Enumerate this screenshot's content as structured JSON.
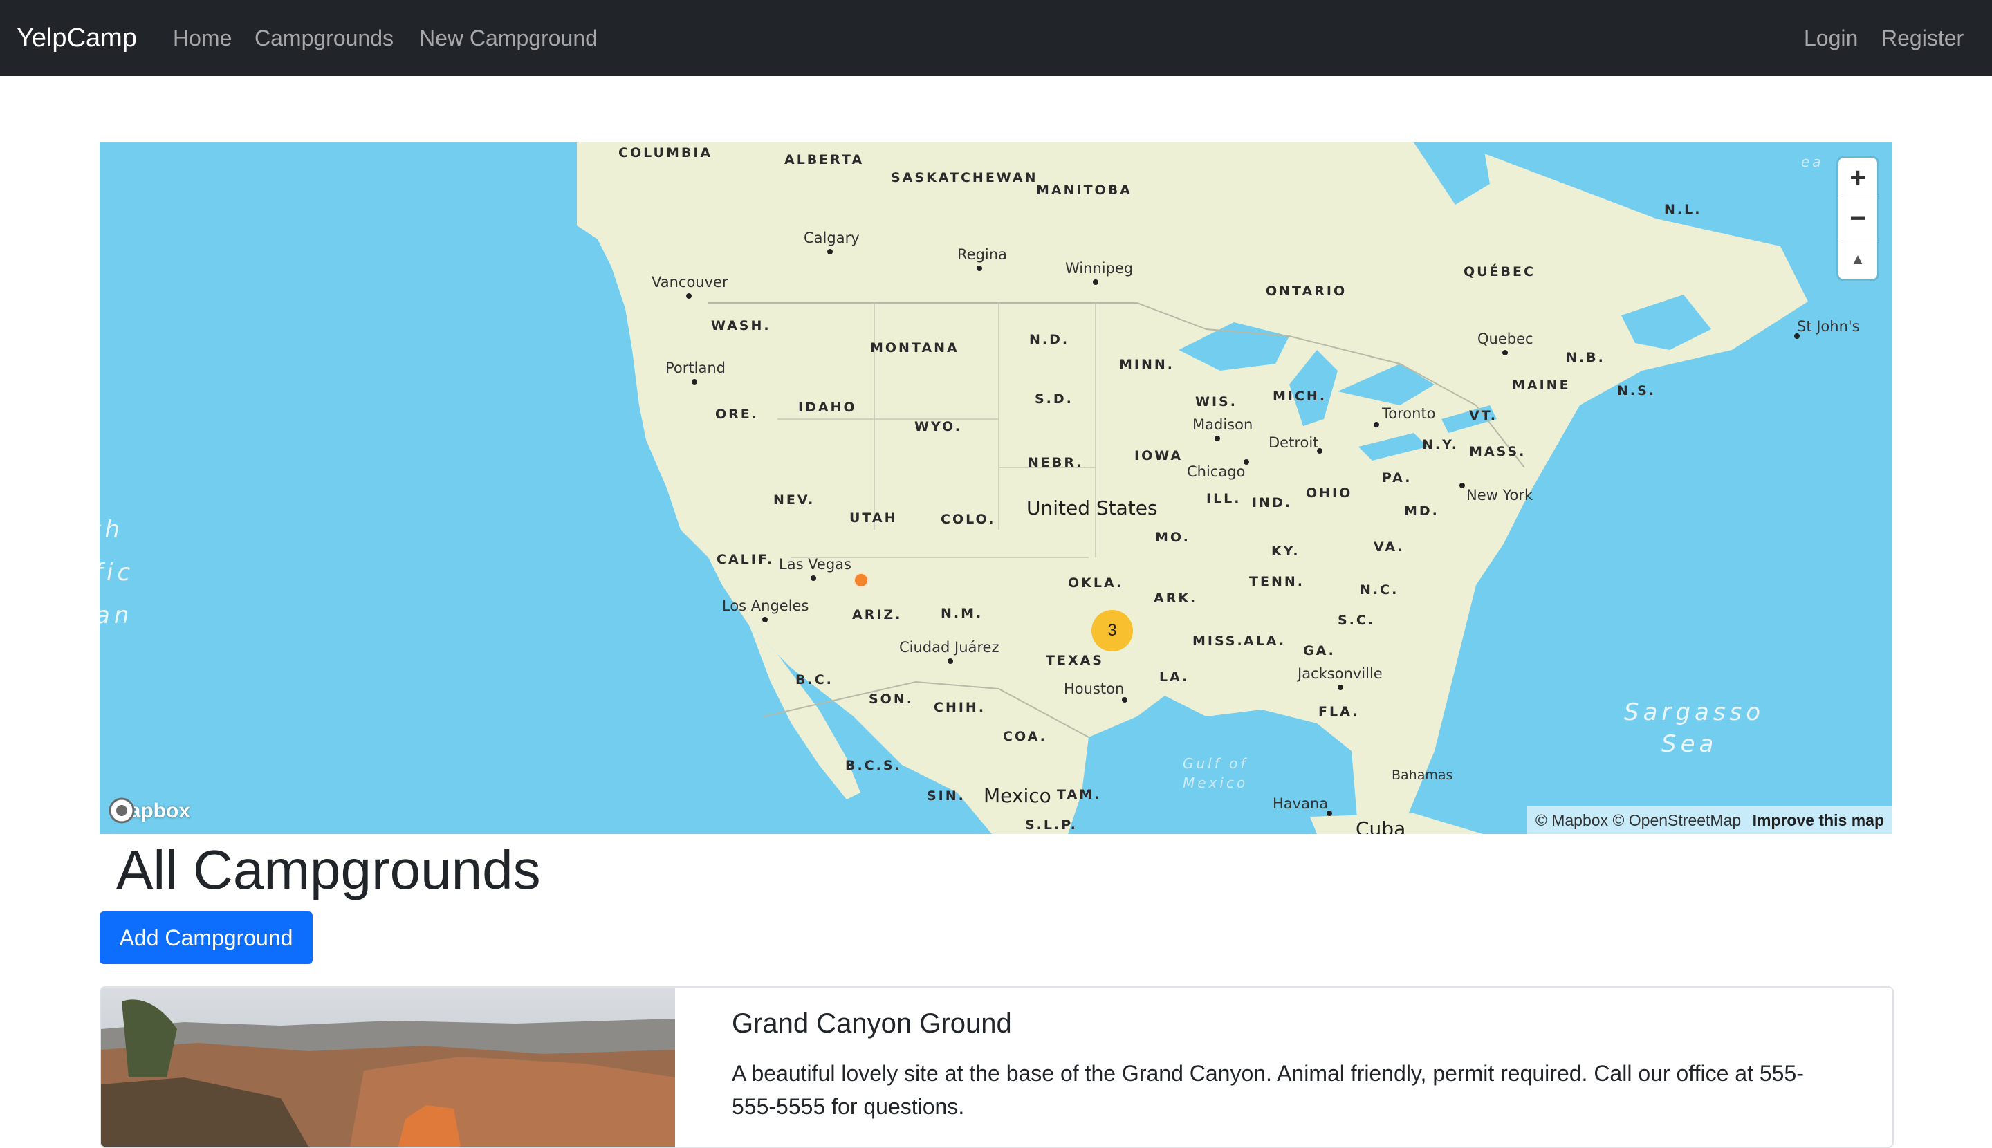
{
  "navbar": {
    "brand": "YelpCamp",
    "links": [
      "Home",
      "Campgrounds",
      "New Campground"
    ],
    "auth": [
      "Login",
      "Register"
    ]
  },
  "map": {
    "provider": "mapbox",
    "attribution": {
      "mapbox": "© Mapbox",
      "osm": "© OpenStreetMap",
      "improve": "Improve this map"
    },
    "country_label": "United States",
    "country_label_2": "Mexico",
    "country_label_3": "Cuba",
    "region_labels": [
      "COLUMBIA",
      "ALBERTA",
      "SASKATCHEWAN",
      "MANITOBA",
      "ONTARIO",
      "QUÉBEC",
      "N.L.",
      "WASH.",
      "MONTANA",
      "N.D.",
      "MINN.",
      "ORE.",
      "IDAHO",
      "WYO.",
      "S.D.",
      "WIS.",
      "MICH.",
      "VT.",
      "N.B.",
      "MAINE",
      "N.S.",
      "NEBR.",
      "IOWA",
      "N.Y.",
      "MASS.",
      "NEV.",
      "UTAH",
      "COLO.",
      "ILL.",
      "IND.",
      "OHIO",
      "PA.",
      "MD.",
      "CALIF.",
      "MO.",
      "KY.",
      "VA.",
      "OKLA.",
      "ARK.",
      "TENN.",
      "N.C.",
      "ARIZ.",
      "N.M.",
      "MISS.",
      "ALA.",
      "S.C.",
      "TEXAS",
      "GA.",
      "LA.",
      "B.C.",
      "SON.",
      "CHIH.",
      "FLA.",
      "COA.",
      "B.C.S.",
      "SIN.",
      "TAM.",
      "S.L.P."
    ],
    "city_labels": [
      "Calgary",
      "Regina",
      "Winnipeg",
      "Vancouver",
      "Quebec",
      "St John's",
      "Portland",
      "Toronto",
      "Madison",
      "Detroit",
      "Chicago",
      "New York",
      "Las Vegas",
      "Los Angeles",
      "Ciudad Juárez",
      "Houston",
      "Jacksonville",
      "Havana",
      "Bahamas"
    ],
    "ocean_labels": [
      "th",
      "fic",
      "an",
      "Sargasso",
      "Sea",
      "Gulf of",
      "Mexico",
      "ea"
    ],
    "cluster_count": "3",
    "zoom_in": "+",
    "zoom_out": "−",
    "compass": "▲"
  },
  "page": {
    "title": "All Campgrounds",
    "add_button": "Add Campground"
  },
  "campgrounds": [
    {
      "title": "Grand Canyon Ground",
      "description": "A beautiful lovely site at the base of the Grand Canyon. Animal friendly, permit required. Call our office at 555-555-5555 for questions."
    }
  ],
  "colors": {
    "navbar_bg": "#212529",
    "primary": "#0d6efd",
    "water": "#73cdef",
    "land": "#eef0d6",
    "cluster": "#f8bf2e",
    "point": "#f4852a"
  }
}
